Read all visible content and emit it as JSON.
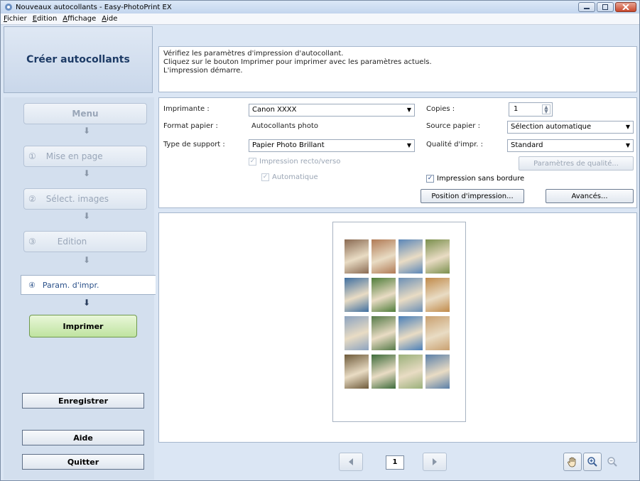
{
  "window": {
    "title": "Nouveaux autocollants - Easy-PhotoPrint EX"
  },
  "menu": [
    "Fichier",
    "Edition",
    "Affichage",
    "Aide"
  ],
  "sidebar": {
    "header": "Créer autocollants",
    "menu_label": "Menu",
    "steps": [
      {
        "num": "①",
        "label": "Mise en page"
      },
      {
        "num": "②",
        "label": "Sélect. images"
      },
      {
        "num": "③",
        "label": "Edition"
      }
    ],
    "current_step": {
      "num": "④",
      "label": "Param. d'impr."
    },
    "print_label": "Imprimer",
    "save_label": "Enregistrer",
    "help_label": "Aide",
    "quit_label": "Quitter"
  },
  "message": {
    "line1": "Vérifiez les paramètres d'impression d'autocollant.",
    "line2": "Cliquez sur le bouton Imprimer pour imprimer avec les paramètres actuels.",
    "line3": "L'impression démarre."
  },
  "settings": {
    "printer_label": "Imprimante :",
    "printer_value": "Canon XXXX",
    "paper_size_label": "Format papier :",
    "paper_size_value": "Autocollants photo",
    "media_label": "Type de support :",
    "media_value": "Papier Photo Brillant",
    "duplex_label": "Impression recto/verso",
    "auto_label": "Automatique",
    "copies_label": "Copies :",
    "copies_value": "1",
    "source_label": "Source papier :",
    "source_value": "Sélection automatique",
    "quality_label": "Qualité d'impr. :",
    "quality_value": "Standard",
    "quality_settings_label": "Paramètres de qualité...",
    "borderless_label": "Impression sans bordure",
    "position_label": "Position d'impression...",
    "advanced_label": "Avancés..."
  },
  "preview": {
    "page_number": "1",
    "thumb_colors": [
      "#8a6a52",
      "#b07a55",
      "#5a86b8",
      "#7a8f4d",
      "#3f6fa0",
      "#4f7d3a",
      "#6b8fb5",
      "#c08a4a",
      "#8ca3c0",
      "#557a48",
      "#4a7fb8",
      "#c9a070",
      "#6e5a3a",
      "#3d6b3a",
      "#9ab07a",
      "#5a7fa8"
    ]
  },
  "icons": {
    "prev": "prev-page-icon",
    "next": "next-page-icon",
    "hand": "hand-tool-icon",
    "zoom_in": "zoom-in-icon",
    "zoom_out": "zoom-out-icon"
  }
}
